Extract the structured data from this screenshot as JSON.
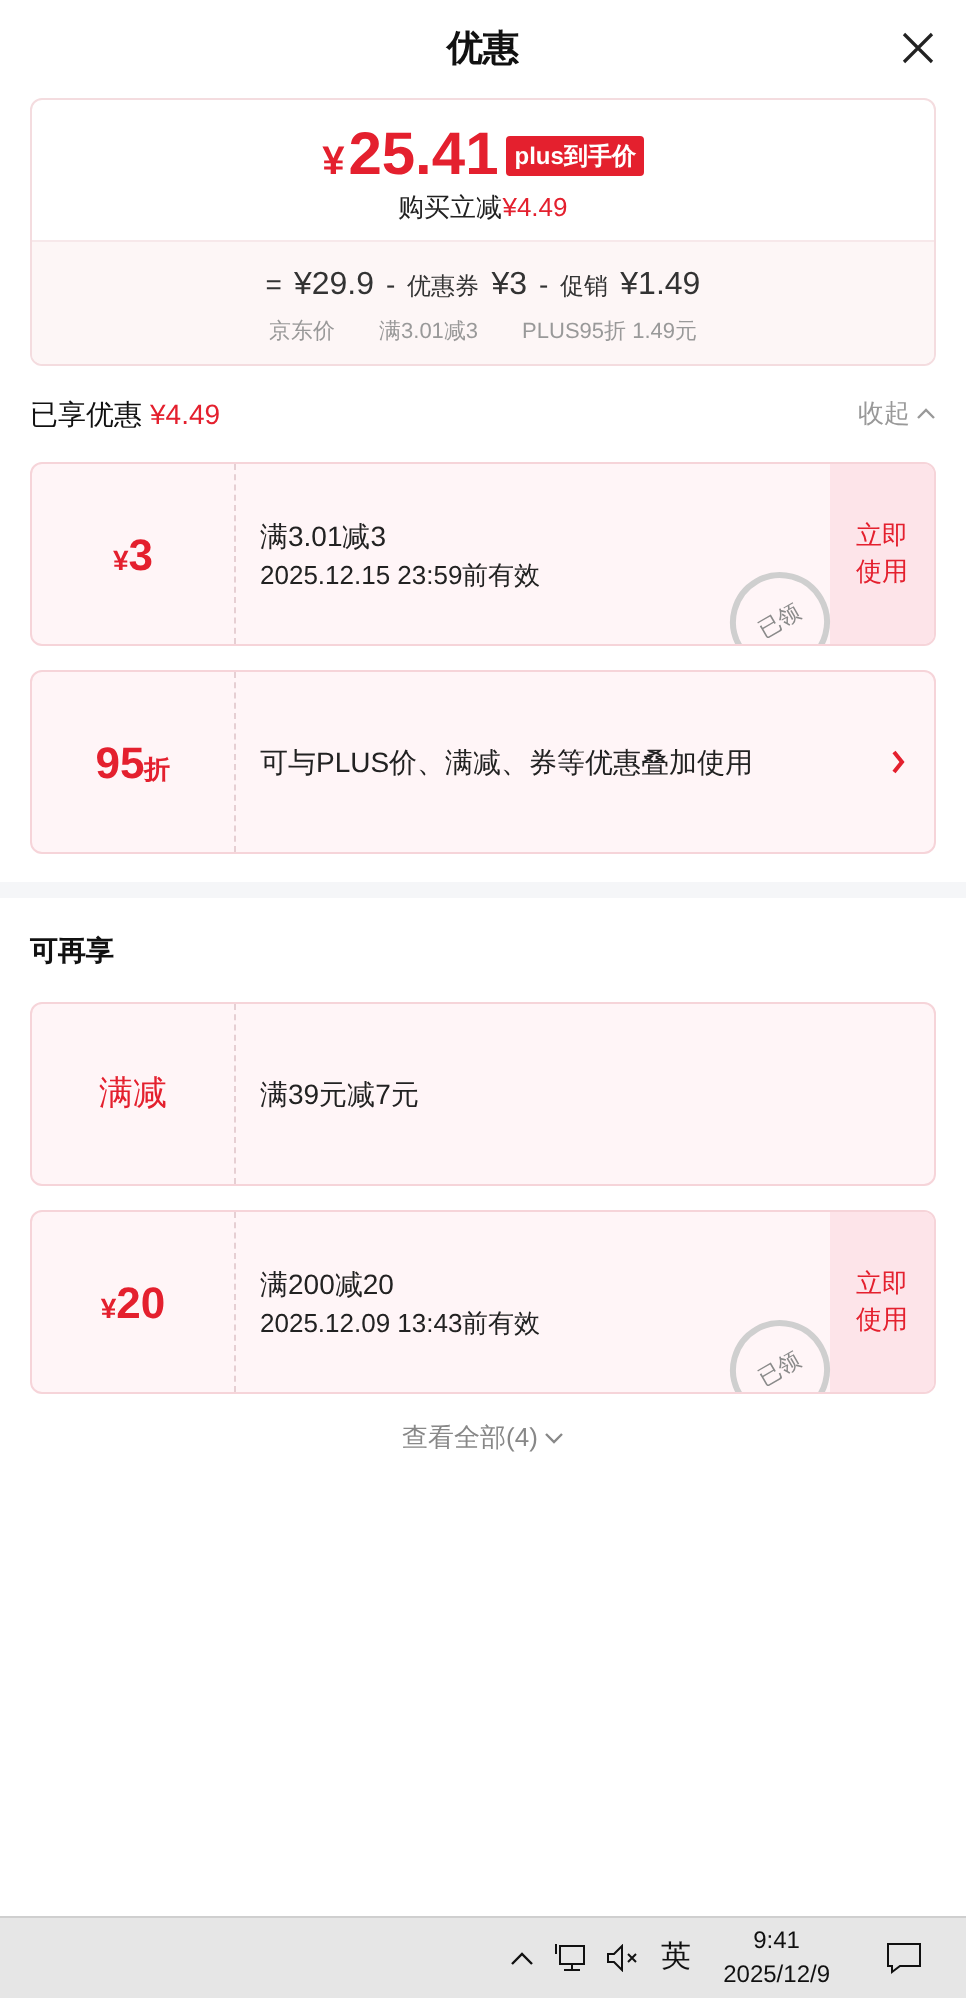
{
  "header": {
    "title": "优惠"
  },
  "summary": {
    "price_symbol": "¥",
    "price": "25.41",
    "badge": "plus到手价",
    "saving_label": "购买立减",
    "saving": "¥4.49",
    "formula": [
      {
        "kind": "op",
        "text": "="
      },
      {
        "kind": "amount",
        "text": "¥29.9"
      },
      {
        "kind": "op",
        "text": "-"
      },
      {
        "kind": "label",
        "text": "优惠券"
      },
      {
        "kind": "amount",
        "text": "¥3"
      },
      {
        "kind": "op",
        "text": "-"
      },
      {
        "kind": "label",
        "text": "促销"
      },
      {
        "kind": "amount",
        "text": "¥1.49"
      }
    ],
    "notes": [
      "京东价",
      "满3.01减3",
      "PLUS95折 1.49元"
    ]
  },
  "sections": [
    {
      "title": "已享优惠",
      "amount": "¥4.49",
      "toggle": "收起",
      "expanded": true,
      "coupons": [
        {
          "kind": "amount",
          "prefix": "¥",
          "value": "3",
          "title": "满3.01减3",
          "validity": "2025.12.15 23:59前有效",
          "claimed": true,
          "stamp": "已领",
          "action": "立即使用"
        },
        {
          "kind": "discount",
          "value": "95",
          "suffix": "折",
          "title": "可与PLUS价、满减、券等优惠叠加使用",
          "claimed": false,
          "link": true
        }
      ]
    },
    {
      "title": "可再享",
      "coupons": [
        {
          "kind": "label",
          "value": "满减",
          "title": "满39元减7元",
          "claimed": false
        },
        {
          "kind": "amount",
          "prefix": "¥",
          "value": "20",
          "title": "满200减20",
          "validity": "2025.12.09 13:43前有效",
          "claimed": true,
          "stamp": "已领",
          "action": "立即使用"
        }
      ],
      "more": "查看全部(4)"
    }
  ],
  "taskbar": {
    "ime": "英",
    "time": "9:41",
    "date": "2025/12/9"
  }
}
